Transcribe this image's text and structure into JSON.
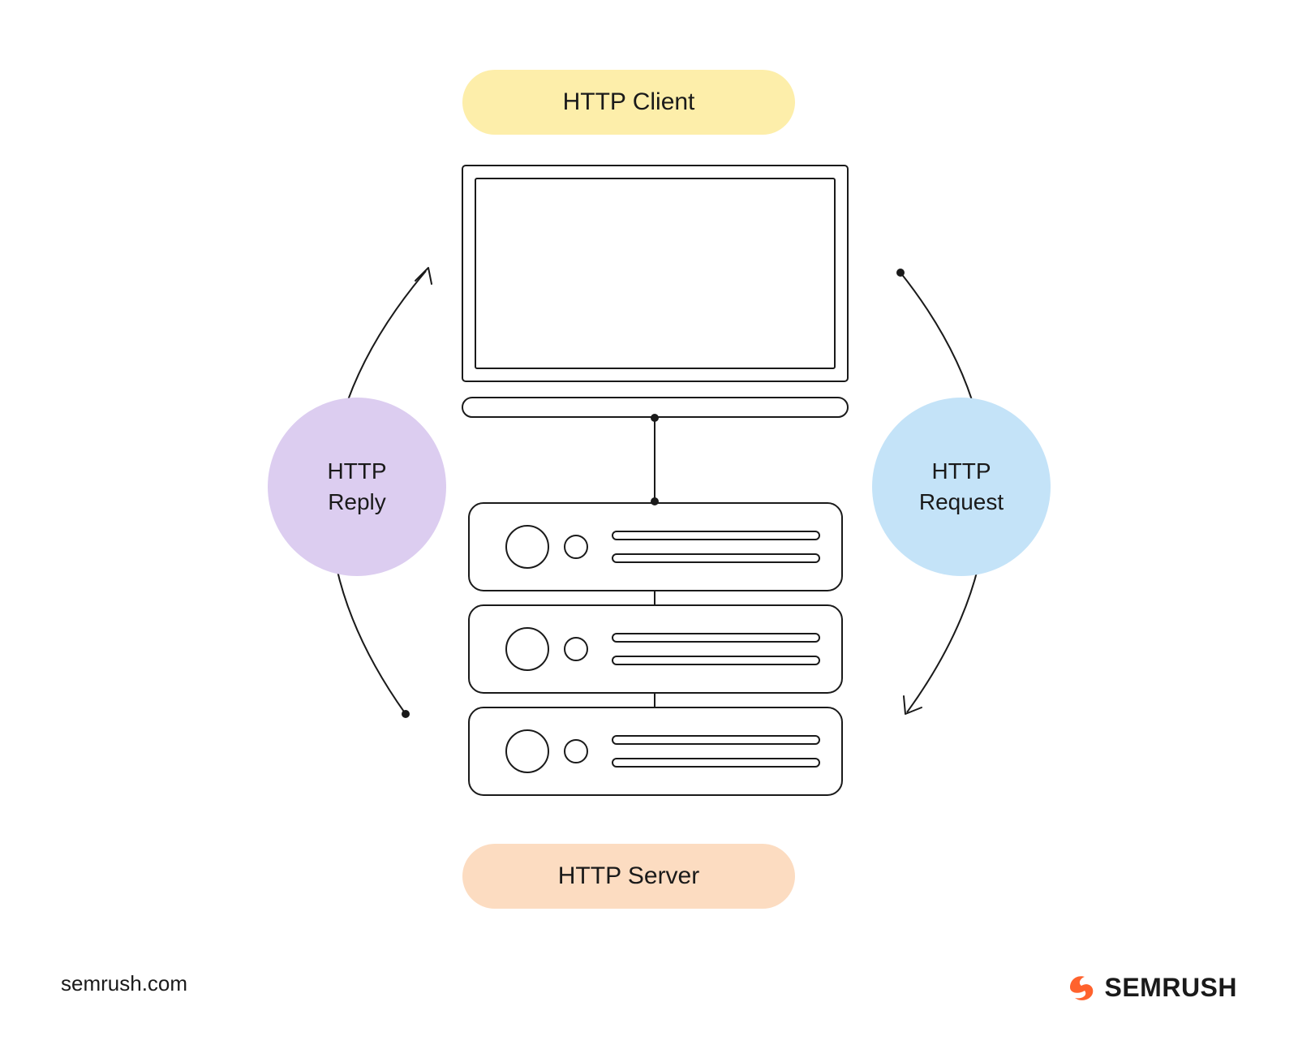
{
  "labels": {
    "top_pill": "HTTP Client",
    "bottom_pill": "HTTP Server",
    "left_bubble_line1": "HTTP",
    "left_bubble_line2": "Reply",
    "right_bubble_line1": "HTTP",
    "right_bubble_line2": "Request"
  },
  "footer": {
    "url": "semrush.com",
    "brand": "SEMRUSH"
  },
  "colors": {
    "top_pill": "#fdeeaa",
    "bottom_pill": "#fcdcc1",
    "left_bubble": "#dccdf0",
    "right_bubble": "#c4e3f8",
    "logo_accent": "#ff622d",
    "stroke": "#1a1a1a"
  },
  "diagram": {
    "description": "HTTP client-server request/reply cycle",
    "nodes": [
      "HTTP Client (monitor)",
      "HTTP Server (rack)"
    ],
    "flows": [
      {
        "from": "HTTP Client",
        "to": "HTTP Server",
        "label": "HTTP Request",
        "side": "right"
      },
      {
        "from": "HTTP Server",
        "to": "HTTP Client",
        "label": "HTTP Reply",
        "side": "left"
      }
    ]
  }
}
